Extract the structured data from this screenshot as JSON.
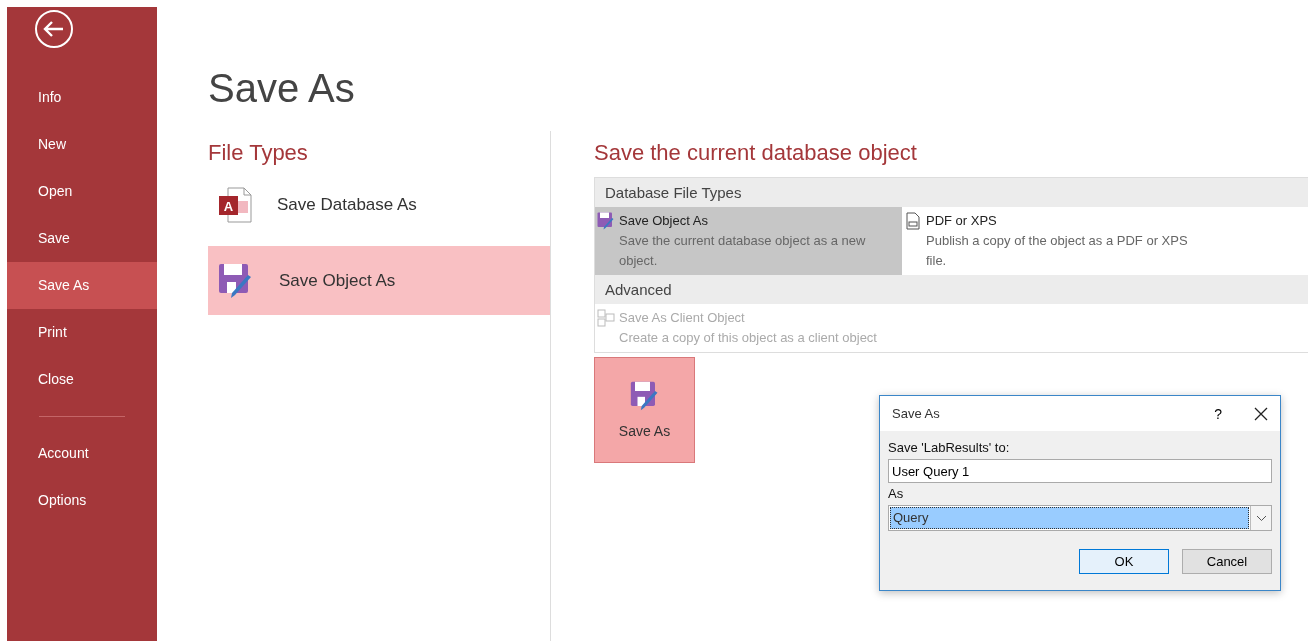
{
  "sidebar": {
    "items": [
      {
        "label": "Info",
        "selected": false
      },
      {
        "label": "New",
        "selected": false
      },
      {
        "label": "Open",
        "selected": false
      },
      {
        "label": "Save",
        "selected": false
      },
      {
        "label": "Save As",
        "selected": true
      },
      {
        "label": "Print",
        "selected": false
      },
      {
        "label": "Close",
        "selected": false
      }
    ],
    "bottom_items": [
      {
        "label": "Account",
        "selected": false
      },
      {
        "label": "Options",
        "selected": false
      }
    ]
  },
  "page_title": "Save As",
  "file_types": {
    "heading": "File Types",
    "items": [
      {
        "label": "Save Database As",
        "kind": "database",
        "icon_letter": "A",
        "selected": false
      },
      {
        "label": "Save Object As",
        "kind": "object",
        "selected": true
      }
    ]
  },
  "save_current": {
    "heading": "Save the current database object",
    "groups": [
      {
        "title": "Database File Types",
        "options": [
          {
            "title": "Save Object As",
            "description": "Save the current database object as a new object.",
            "kind": "object",
            "selected": true,
            "disabled": false
          },
          {
            "title": "PDF or XPS",
            "description": "Publish a copy of the object as a PDF or XPS file.",
            "kind": "pdf",
            "selected": false,
            "disabled": false
          }
        ]
      },
      {
        "title": "Advanced",
        "options": [
          {
            "title": "Save As Client Object",
            "description": "Create a copy of this object as a client object",
            "kind": "client",
            "selected": false,
            "disabled": true
          }
        ]
      }
    ],
    "save_as_button": "Save As"
  },
  "dialog": {
    "title": "Save As",
    "help": "?",
    "name_label": "Save 'LabResults' to:",
    "name_value": "User Query 1",
    "type_label": "As",
    "type_value": "Query",
    "buttons": [
      {
        "label": "OK",
        "default": true
      },
      {
        "label": "Cancel",
        "default": false
      }
    ]
  }
}
